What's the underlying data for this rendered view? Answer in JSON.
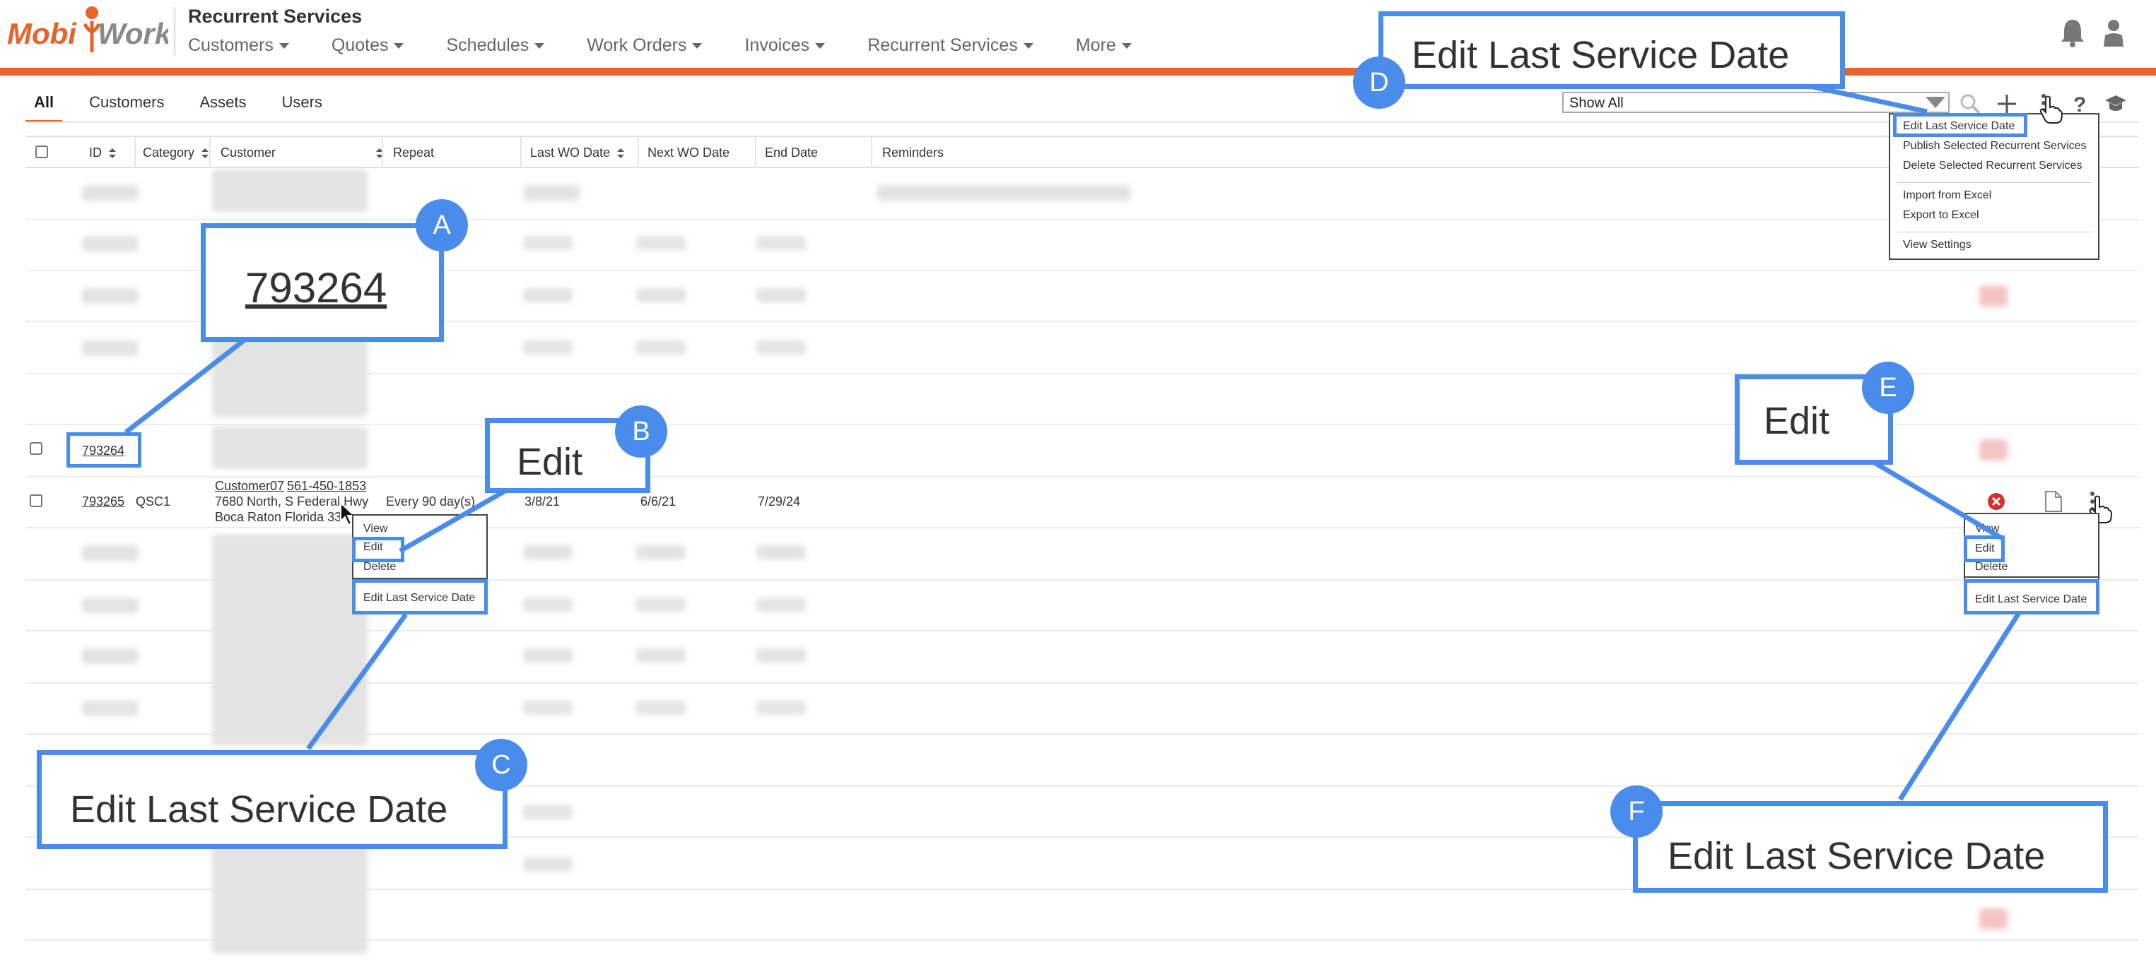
{
  "header": {
    "brand": "MobiWork",
    "title": "Recurrent Services",
    "nav": [
      "Customers",
      "Quotes",
      "Schedules",
      "Work Orders",
      "Invoices",
      "Recurrent Services",
      "More"
    ]
  },
  "tabs": [
    "All",
    "Customers",
    "Assets",
    "Users"
  ],
  "filter": {
    "selected": "Show All"
  },
  "table": {
    "columns": [
      "ID",
      "Category",
      "Customer",
      "Repeat",
      "Last WO Date",
      "Next WO Date",
      "End Date",
      "Reminders"
    ],
    "row_a": {
      "id": "793264"
    },
    "row_b": {
      "id": "793265",
      "category": "QSC1",
      "customer_name": "Customer07",
      "customer_phone": "561-450-1853",
      "address_line1": "7680 North, S Federal Hwy",
      "address_line2": "Boca Raton Florida 33",
      "repeat": "Every 90 day(s)",
      "last_wo": "3/8/21",
      "next_wo": "6/6/21",
      "end": "7/29/24"
    }
  },
  "top_menu": {
    "items": [
      "Edit Last Service Date",
      "Publish Selected Recurrent Services",
      "Delete Selected Recurrent Services",
      "Import from Excel",
      "Export to Excel",
      "View Settings"
    ]
  },
  "row_menu": {
    "items": [
      "View",
      "Edit",
      "Delete",
      "Edit Last Service Date"
    ]
  },
  "callouts": {
    "A": {
      "badge": "A",
      "text": "793264"
    },
    "B": {
      "badge": "B",
      "text": "Edit"
    },
    "C": {
      "badge": "C",
      "text": "Edit Last Service Date"
    },
    "D": {
      "badge": "D",
      "text": "Edit Last Service Date"
    },
    "E": {
      "badge": "E",
      "text": "Edit"
    },
    "F": {
      "badge": "F",
      "text": "Edit Last Service Date"
    }
  },
  "colors": {
    "accent": "#e8622a",
    "callout": "#4a8cec",
    "delete_icon": "#d62f2f"
  }
}
